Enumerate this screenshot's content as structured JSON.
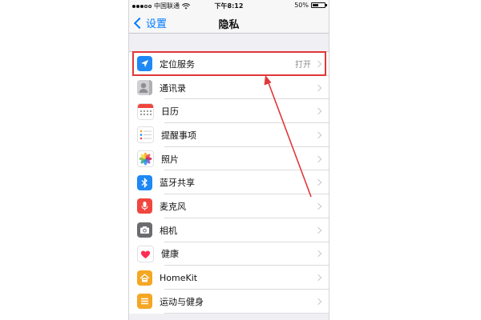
{
  "status_bar": {
    "carrier": "中国联通",
    "time": "下午8:12",
    "battery_percent": "50%",
    "battery_level": 0.5
  },
  "nav": {
    "back_label": "设置",
    "title": "隐私"
  },
  "rows": [
    {
      "name": "location-services",
      "label": "定位服务",
      "detail": "打开",
      "icon": "location-arrow-icon",
      "bg": "#1e88f5"
    },
    {
      "name": "contacts",
      "label": "通讯录",
      "detail": "",
      "icon": "contacts-icon",
      "bg": "#c8c8cc"
    },
    {
      "name": "calendar",
      "label": "日历",
      "detail": "",
      "icon": "calendar-icon",
      "bg": "#ffffff"
    },
    {
      "name": "reminders",
      "label": "提醒事项",
      "detail": "",
      "icon": "reminders-icon",
      "bg": "#ffffff"
    },
    {
      "name": "photos",
      "label": "照片",
      "detail": "",
      "icon": "photos-flower-icon",
      "bg": "#ffffff"
    },
    {
      "name": "bluetooth-sharing",
      "label": "蓝牙共享",
      "detail": "",
      "icon": "bluetooth-icon",
      "bg": "#1e88f5"
    },
    {
      "name": "microphone",
      "label": "麦克风",
      "detail": "",
      "icon": "microphone-icon",
      "bg": "#f0463f"
    },
    {
      "name": "camera",
      "label": "相机",
      "detail": "",
      "icon": "camera-icon",
      "bg": "#6b6b70"
    },
    {
      "name": "health",
      "label": "健康",
      "detail": "",
      "icon": "heart-icon",
      "bg": "#ffffff"
    },
    {
      "name": "homekit",
      "label": "HomeKit",
      "detail": "",
      "icon": "home-icon",
      "bg": "#f5a623"
    },
    {
      "name": "motion-fitness",
      "label": "运动与健身",
      "detail": "",
      "icon": "motion-icon",
      "bg": "#f5a623"
    }
  ],
  "colors": {
    "accent": "#007aff",
    "annotation": "#e0373a"
  }
}
